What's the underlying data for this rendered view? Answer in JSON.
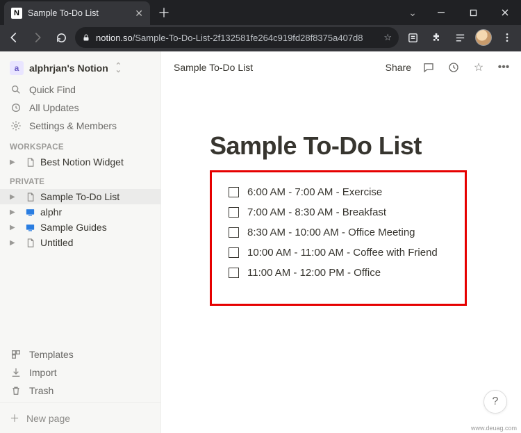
{
  "browser": {
    "tab_title": "Sample To-Do List",
    "tab_favicon_letter": "N",
    "url_domain": "notion.so",
    "url_path": "/Sample-To-Do-List-2f132581fe264c919fd28f8375a407d8"
  },
  "sidebar": {
    "workspace_name": "alphrjan's Notion",
    "quick_find": "Quick Find",
    "all_updates": "All Updates",
    "settings": "Settings & Members",
    "section_workspace": "WORKSPACE",
    "section_private": "PRIVATE",
    "workspace_pages": [
      {
        "label": "Best Notion Widget",
        "icon": "page"
      }
    ],
    "private_pages": [
      {
        "label": "Sample To-Do List",
        "icon": "page",
        "selected": true
      },
      {
        "label": "alphr",
        "icon": "blue"
      },
      {
        "label": "Sample Guides",
        "icon": "blue"
      },
      {
        "label": "Untitled",
        "icon": "page"
      }
    ],
    "templates": "Templates",
    "import": "Import",
    "trash": "Trash",
    "new_page": "New page"
  },
  "topbar": {
    "breadcrumb": "Sample To-Do List",
    "share": "Share"
  },
  "page": {
    "title": "Sample To-Do List",
    "todos": [
      "6:00 AM - 7:00 AM - Exercise",
      "7:00 AM - 8:30 AM - Breakfast",
      "8:30 AM - 10:00 AM - Office Meeting",
      "10:00 AM - 11:00 AM - Coffee with Friend",
      "11:00 AM - 12:00 PM - Office"
    ]
  },
  "help_label": "?",
  "watermark": "www.deuag.com"
}
